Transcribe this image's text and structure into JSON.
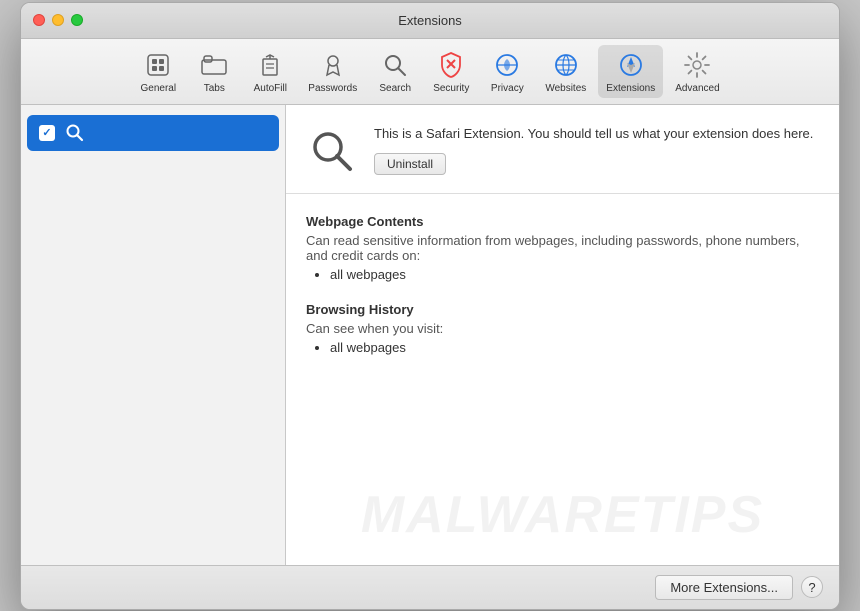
{
  "window": {
    "title": "Extensions"
  },
  "traffic_lights": {
    "close": "close",
    "minimize": "minimize",
    "maximize": "maximize"
  },
  "toolbar": {
    "items": [
      {
        "id": "general",
        "label": "General",
        "icon": "general"
      },
      {
        "id": "tabs",
        "label": "Tabs",
        "icon": "tabs"
      },
      {
        "id": "autofill",
        "label": "AutoFill",
        "icon": "autofill"
      },
      {
        "id": "passwords",
        "label": "Passwords",
        "icon": "passwords"
      },
      {
        "id": "search",
        "label": "Search",
        "icon": "search"
      },
      {
        "id": "security",
        "label": "Security",
        "icon": "security"
      },
      {
        "id": "privacy",
        "label": "Privacy",
        "icon": "privacy"
      },
      {
        "id": "websites",
        "label": "Websites",
        "icon": "websites"
      },
      {
        "id": "extensions",
        "label": "Extensions",
        "icon": "extensions",
        "active": true
      },
      {
        "id": "advanced",
        "label": "Advanced",
        "icon": "advanced"
      }
    ]
  },
  "sidebar": {
    "items": [
      {
        "id": "search-ext",
        "label": "Search",
        "checked": true,
        "selected": true
      }
    ]
  },
  "detail": {
    "ext_description": "This is a Safari Extension. You should tell us what your extension does here.",
    "uninstall_label": "Uninstall",
    "permissions": [
      {
        "title": "Webpage Contents",
        "desc": "Can read sensitive information from webpages, including passwords, phone numbers, and credit cards on:",
        "items": [
          "all webpages"
        ]
      },
      {
        "title": "Browsing History",
        "desc": "Can see when you visit:",
        "items": [
          "all webpages"
        ]
      }
    ]
  },
  "bottombar": {
    "more_extensions_label": "More Extensions...",
    "help_label": "?"
  },
  "watermark": {
    "text": "MALWARETIPS"
  }
}
